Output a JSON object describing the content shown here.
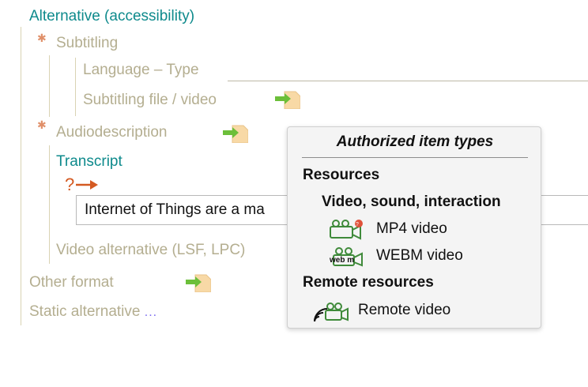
{
  "tree": {
    "root_label": "Alternative (accessibility)",
    "subtitling": {
      "label": "Subtitling",
      "language_type_label": "Language – Type",
      "file_video_label": "Subtitling file / video"
    },
    "audiodescription_label": "Audiodescription",
    "transcript": {
      "label": "Transcript",
      "help_icon": "question-arrow-icon",
      "text_value": "Internet of Things are a ma"
    },
    "video_alternative_label": "Video alternative (LSF, LPC)",
    "other_format_label": "Other format",
    "static_alternative_label": "Static alternative",
    "static_alternative_more": "..."
  },
  "popup": {
    "title": "Authorized item types",
    "section_resources": "Resources",
    "subsection_video": "Video, sound, interaction",
    "items": [
      {
        "label": "MP4 video",
        "icon": "mp4-video-icon"
      },
      {
        "label": "WEBM video",
        "icon": "webm-video-icon"
      }
    ],
    "section_remote": "Remote resources",
    "remote_item": {
      "label": "Remote video",
      "icon": "remote-video-icon"
    }
  },
  "colors": {
    "accent_teal": "#0e8a8c",
    "muted_text": "#b4ae90",
    "required_star": "#e0906a",
    "insert_icon_green": "#6cbf3a",
    "insert_icon_bg": "#f8d9a6"
  }
}
